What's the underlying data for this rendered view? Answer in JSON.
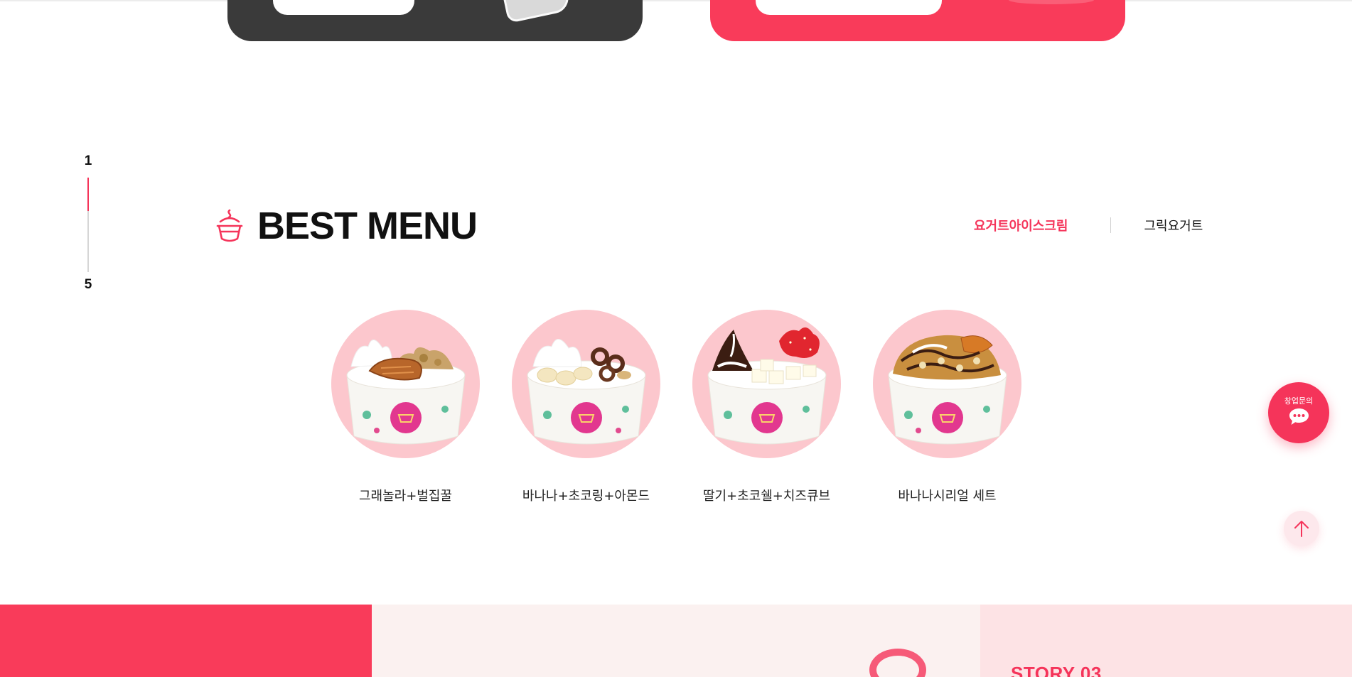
{
  "banners": {
    "left": {
      "pill_text": ""
    },
    "right": {
      "pill_text": ""
    }
  },
  "pager": {
    "current": "1",
    "total": "5",
    "progress": 0.35
  },
  "best_menu": {
    "title": "BEST MENU",
    "tabs": [
      {
        "label": "요거트아이스크림",
        "active": true
      },
      {
        "label": "그릭요거트",
        "active": false
      }
    ],
    "items": [
      {
        "name": "그래놀라+벌집꿀"
      },
      {
        "name": "바나나+초코링+아몬드"
      },
      {
        "name": "딸기+초코쉘+치즈큐브"
      },
      {
        "name": "바나나시리얼 세트"
      }
    ]
  },
  "floating": {
    "chat_label": "창업문의",
    "chat_icon": "chat-bubble-icon",
    "top_icon": "arrow-up-icon"
  },
  "story": {
    "label": "STORY 03"
  },
  "colors": {
    "accent": "#f5345a",
    "banner_dark": "#3a3a3a",
    "banner_red": "#f93b5a",
    "photo_bg": "#fcc7cd"
  }
}
